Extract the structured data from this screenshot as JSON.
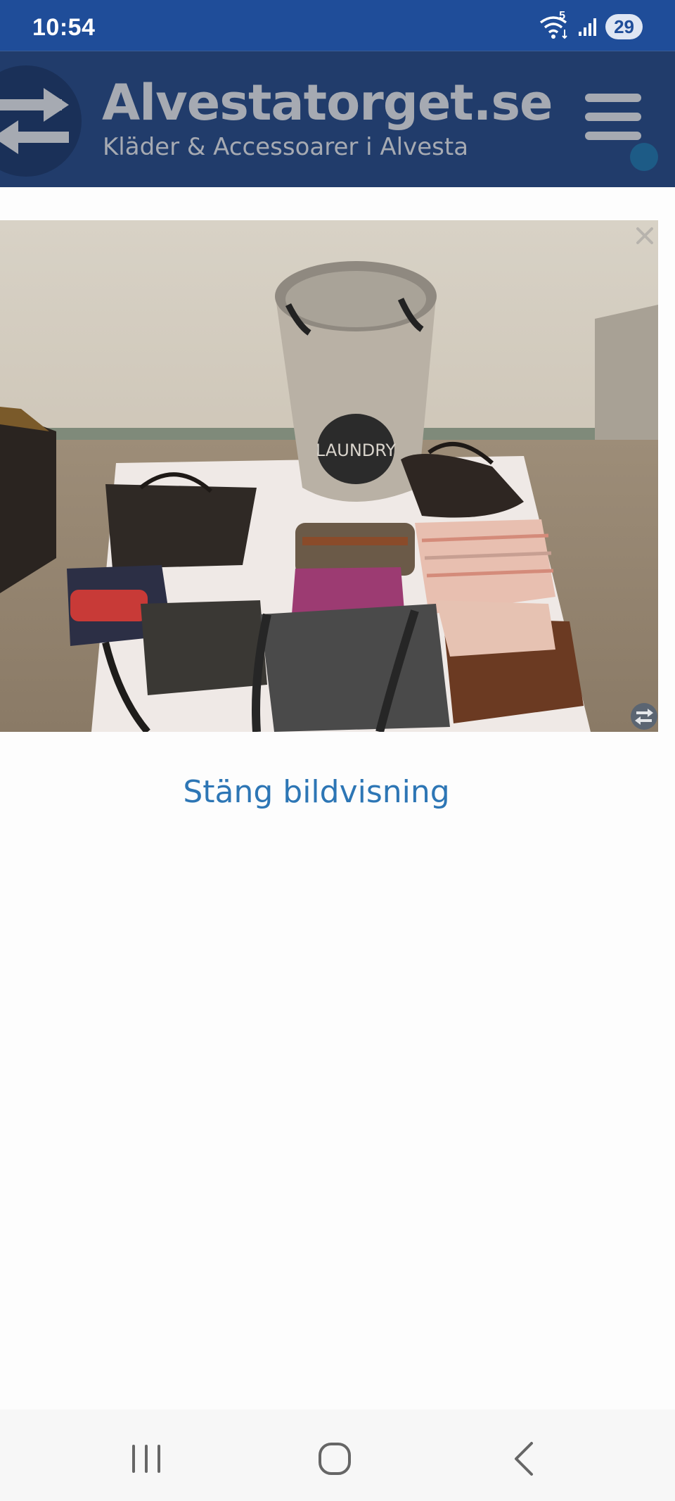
{
  "status_bar": {
    "time": "10:54",
    "battery": "29",
    "wifi_badge": "5",
    "icons": [
      "wifi-icon",
      "signal-icon",
      "battery-icon"
    ]
  },
  "header": {
    "site_title": "Alvestatorget.se",
    "site_subtitle": "Kläder & Accessoarer i Alvesta",
    "logo_icon": "swap-arrows-icon",
    "menu_icon": "hamburger-menu-icon"
  },
  "gallery": {
    "image_alt": "Väskor och tvättkorg",
    "basket_text": "LAUNDRY",
    "close_icon": "close-icon",
    "swap_icon": "swap-icon",
    "close_label": "Stäng bildvisning"
  },
  "nav_bar": {
    "icons": [
      "recent-apps-icon",
      "home-icon",
      "back-icon"
    ]
  },
  "colors": {
    "status_bar": "#1f4d99",
    "header": "#213c6b",
    "link": "#2d76b5",
    "title_gray": "#a6aab2"
  }
}
